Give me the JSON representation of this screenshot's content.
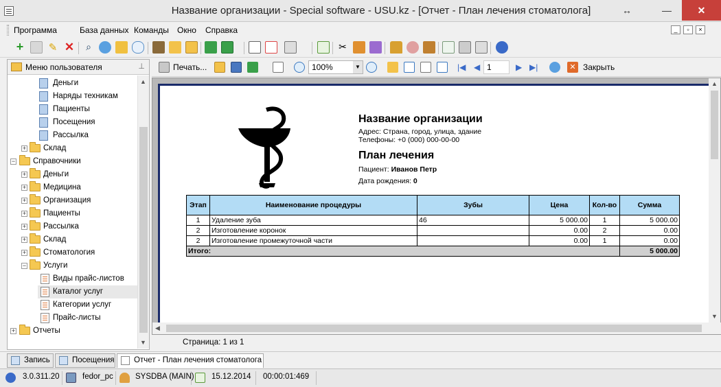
{
  "window": {
    "title": "Название организации - Special software - USU.kz - [Отчет - План лечения стоматолога]"
  },
  "menu": [
    "Программа",
    "База данных",
    "Команды",
    "Окно",
    "Справка"
  ],
  "left_panel": {
    "title": "Меню пользователя",
    "tree": [
      {
        "label": "Деньги",
        "kind": "doc"
      },
      {
        "label": "Наряды техникам",
        "kind": "doc"
      },
      {
        "label": "Пациенты",
        "kind": "doc"
      },
      {
        "label": "Посещения",
        "kind": "doc"
      },
      {
        "label": "Рассылка",
        "kind": "doc"
      },
      {
        "label": "Склад",
        "kind": "folder"
      },
      {
        "label": "Справочники",
        "kind": "folder"
      },
      {
        "label": "Деньги",
        "kind": "folder"
      },
      {
        "label": "Медицина",
        "kind": "folder"
      },
      {
        "label": "Организация",
        "kind": "folder"
      },
      {
        "label": "Пациенты",
        "kind": "folder"
      },
      {
        "label": "Рассылка",
        "kind": "folder"
      },
      {
        "label": "Склад",
        "kind": "folder"
      },
      {
        "label": "Стоматология",
        "kind": "folder"
      },
      {
        "label": "Услуги",
        "kind": "folder"
      },
      {
        "label": "Виды прайс-листов",
        "kind": "list"
      },
      {
        "label": "Каталог услуг",
        "kind": "list"
      },
      {
        "label": "Категории услуг",
        "kind": "list"
      },
      {
        "label": "Прайс-листы",
        "kind": "list"
      },
      {
        "label": "Отчеты",
        "kind": "folder"
      }
    ]
  },
  "report_toolbar": {
    "print_label": "Печать...",
    "zoom": "100%",
    "page": "1",
    "close_label": "Закрыть"
  },
  "report": {
    "org_title": "Название организации",
    "address": "Адрес: Страна, город, улица, здание",
    "phone": "Телефоны: +0 (000) 000-00-00",
    "plan_title": "План лечения",
    "patient_label": "Пациент:",
    "patient_name": "Иванов Петр",
    "dob_label": "Дата рождения:",
    "dob_value": "0",
    "columns": [
      "Этап",
      "Наименование процедуры",
      "Зубы",
      "Цена",
      "Кол-во",
      "Сумма"
    ],
    "rows": [
      [
        "1",
        "Удаление зуба",
        "46",
        "5 000.00",
        "1",
        "5 000.00"
      ],
      [
        "2",
        "Изготовление коронок",
        "",
        "0.00",
        "2",
        "0.00"
      ],
      [
        "2",
        "Изготовление промежуточной части",
        "",
        "0.00",
        "1",
        "0.00"
      ]
    ],
    "total_label": "Итого:",
    "total_value": "5 000.00"
  },
  "page_status": "Страница: 1 из 1",
  "tabs": [
    "Запись",
    "Посещения",
    "Отчет - План лечения стоматолога"
  ],
  "statusbar": {
    "version": "3.0.311.20",
    "computer": "fedor_pc",
    "user": "SYSDBA (MAIN)",
    "date": "15.12.2014",
    "timer": "00:00:01:469"
  }
}
